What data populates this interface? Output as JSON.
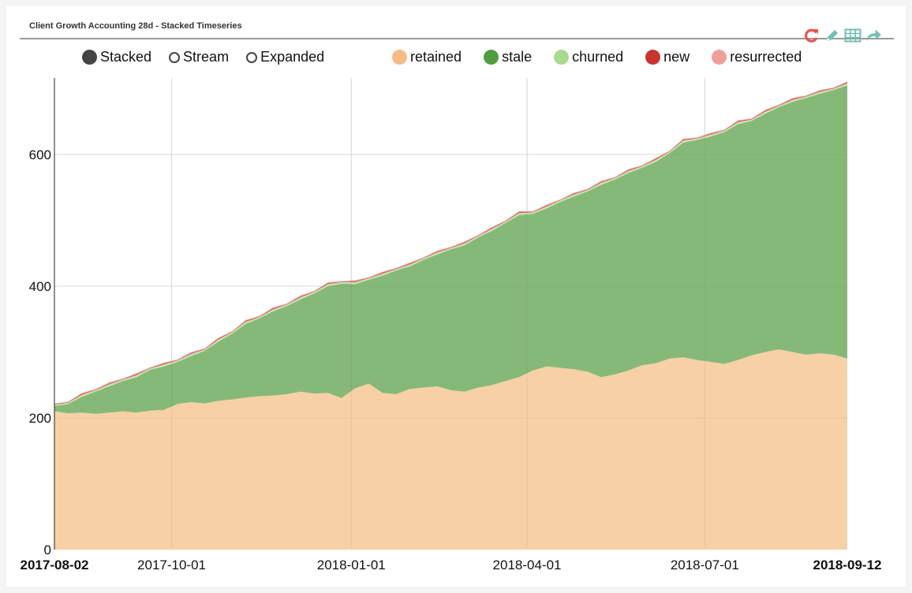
{
  "header": {
    "title": "Client Growth Accounting 28d - Stacked Timeseries",
    "tools": [
      {
        "name": "refresh-icon",
        "glyph": "refresh",
        "color": "#e8554e"
      },
      {
        "name": "edit-icon",
        "glyph": "pencil",
        "color": "#6fc0b3"
      },
      {
        "name": "table-icon",
        "glyph": "table",
        "color": "#6fc0b3"
      },
      {
        "name": "share-icon",
        "glyph": "share",
        "color": "#6fc0b3"
      }
    ]
  },
  "controls": {
    "modes": [
      {
        "label": "Stacked",
        "selected": true
      },
      {
        "label": "Stream",
        "selected": false
      },
      {
        "label": "Expanded",
        "selected": false
      }
    ]
  },
  "legend": [
    {
      "label": "retained",
      "color": "#f7bb86"
    },
    {
      "label": "stale",
      "color": "#4f9e3f"
    },
    {
      "label": "churned",
      "color": "#a9db8f"
    },
    {
      "label": "new",
      "color": "#c9342f"
    },
    {
      "label": "resurrected",
      "color": "#f0a09c"
    }
  ],
  "chart_data": {
    "type": "area",
    "stacked": true,
    "title": "Client Growth Accounting 28d - Stacked Timeseries",
    "xlabel": "",
    "ylabel": "",
    "x_range": [
      "2017-08-02",
      "2018-09-12"
    ],
    "ylim": [
      0,
      716
    ],
    "y_ticks": [
      0,
      200,
      400,
      600
    ],
    "x_ticks": [
      {
        "label": "2017-08-02",
        "bold": true
      },
      {
        "label": "2017-10-01",
        "bold": false
      },
      {
        "label": "2018-01-01",
        "bold": false
      },
      {
        "label": "2018-04-01",
        "bold": false
      },
      {
        "label": "2018-07-01",
        "bold": false
      },
      {
        "label": "2018-09-12",
        "bold": true
      }
    ],
    "grid": true,
    "legend_position": "top",
    "x": [
      "2017-08-02",
      "2017-08-09",
      "2017-08-16",
      "2017-08-23",
      "2017-08-30",
      "2017-09-06",
      "2017-09-13",
      "2017-09-20",
      "2017-09-27",
      "2017-10-04",
      "2017-10-11",
      "2017-10-18",
      "2017-10-25",
      "2017-11-01",
      "2017-11-08",
      "2017-11-15",
      "2017-11-22",
      "2017-11-29",
      "2017-12-06",
      "2017-12-13",
      "2017-12-20",
      "2017-12-27",
      "2018-01-03",
      "2018-01-10",
      "2018-01-17",
      "2018-01-24",
      "2018-01-31",
      "2018-02-07",
      "2018-02-14",
      "2018-02-21",
      "2018-02-28",
      "2018-03-07",
      "2018-03-14",
      "2018-03-21",
      "2018-03-28",
      "2018-04-04",
      "2018-04-11",
      "2018-04-18",
      "2018-04-25",
      "2018-05-02",
      "2018-05-09",
      "2018-05-16",
      "2018-05-23",
      "2018-05-30",
      "2018-06-06",
      "2018-06-13",
      "2018-06-20",
      "2018-06-27",
      "2018-07-04",
      "2018-07-11",
      "2018-07-18",
      "2018-07-25",
      "2018-08-01",
      "2018-08-08",
      "2018-08-15",
      "2018-08-22",
      "2018-08-29",
      "2018-09-05",
      "2018-09-12"
    ],
    "series": [
      {
        "name": "retained",
        "values": [
          210,
          207,
          208,
          206,
          208,
          210,
          208,
          211,
          212,
          221,
          224,
          222,
          226,
          228,
          231,
          233,
          234,
          236,
          240,
          237,
          238,
          230,
          245,
          252,
          238,
          236,
          244,
          246,
          248,
          242,
          240,
          246,
          250,
          256,
          262,
          272,
          278,
          276,
          274,
          270,
          262,
          266,
          272,
          280,
          283,
          290,
          292,
          288,
          285,
          282,
          288,
          295,
          300,
          304,
          300,
          296,
          298,
          296,
          290
        ]
      },
      {
        "name": "stale",
        "values": [
          8,
          14,
          24,
          34,
          40,
          46,
          54,
          62,
          66,
          64,
          70,
          80,
          90,
          100,
          112,
          118,
          128,
          134,
          140,
          152,
          162,
          174,
          158,
          158,
          178,
          188,
          186,
          194,
          200,
          214,
          222,
          228,
          234,
          240,
          246,
          238,
          240,
          252,
          262,
          274,
          292,
          296,
          300,
          300,
          306,
          312,
          326,
          334,
          342,
          352,
          358,
          356,
          362,
          368,
          380,
          390,
          394,
          402,
          415
        ]
      },
      {
        "name": "churned",
        "values": [
          2,
          2,
          3,
          2,
          3,
          2,
          3,
          2,
          3,
          2,
          3,
          2,
          3,
          2,
          3,
          2,
          3,
          2,
          3,
          2,
          3,
          2,
          3,
          2,
          3,
          2,
          3,
          2,
          3,
          2,
          3,
          2,
          3,
          2,
          3,
          2,
          3,
          2,
          3,
          2,
          3,
          2,
          3,
          2,
          3,
          2,
          3,
          2,
          3,
          2,
          3,
          2,
          3,
          2,
          3,
          2,
          3,
          2,
          3
        ]
      },
      {
        "name": "new",
        "values": [
          1,
          1,
          2,
          1,
          2,
          1,
          2,
          1,
          2,
          1,
          2,
          1,
          2,
          1,
          2,
          1,
          2,
          1,
          2,
          1,
          2,
          1,
          2,
          1,
          2,
          1,
          2,
          1,
          2,
          1,
          2,
          1,
          2,
          1,
          2,
          1,
          2,
          1,
          2,
          1,
          2,
          1,
          2,
          1,
          2,
          1,
          2,
          1,
          2,
          1,
          2,
          1,
          2,
          1,
          2,
          1,
          2,
          1,
          2
        ]
      },
      {
        "name": "resurrected",
        "values": [
          1,
          1,
          1,
          1,
          1,
          1,
          1,
          1,
          1,
          1,
          1,
          1,
          1,
          1,
          1,
          1,
          1,
          1,
          1,
          1,
          1,
          1,
          1,
          1,
          1,
          1,
          1,
          1,
          1,
          1,
          1,
          1,
          1,
          1,
          1,
          1,
          1,
          1,
          1,
          1,
          1,
          1,
          1,
          1,
          1,
          1,
          1,
          1,
          1,
          1,
          1,
          1,
          1,
          1,
          1,
          1,
          1,
          1,
          1
        ]
      }
    ],
    "series_colors": {
      "retained": "#f7d0a6",
      "stale": "#86b978",
      "churned": "#c3e5b4",
      "new": "#d9605c",
      "resurrected": "#f3b7b4"
    }
  }
}
